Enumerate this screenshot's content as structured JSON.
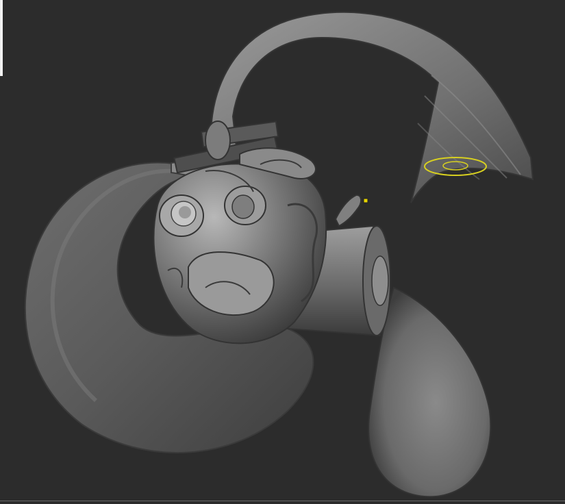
{
  "app": {
    "type": "3d-sculpting-viewport"
  },
  "viewport": {
    "background_color": "#2c2c2c",
    "model_color": "#7a7a7a",
    "model_highlight": "#b4b4b4",
    "model_shadow": "#3a3a3a"
  },
  "brush_cursor": {
    "icon": "brush-ring-icon",
    "color": "#d8d020"
  },
  "pivot_marker": {
    "icon": "transpose-point-icon",
    "color": "#e6d400"
  },
  "panel_edge": {
    "color": "#f2f2f2"
  }
}
